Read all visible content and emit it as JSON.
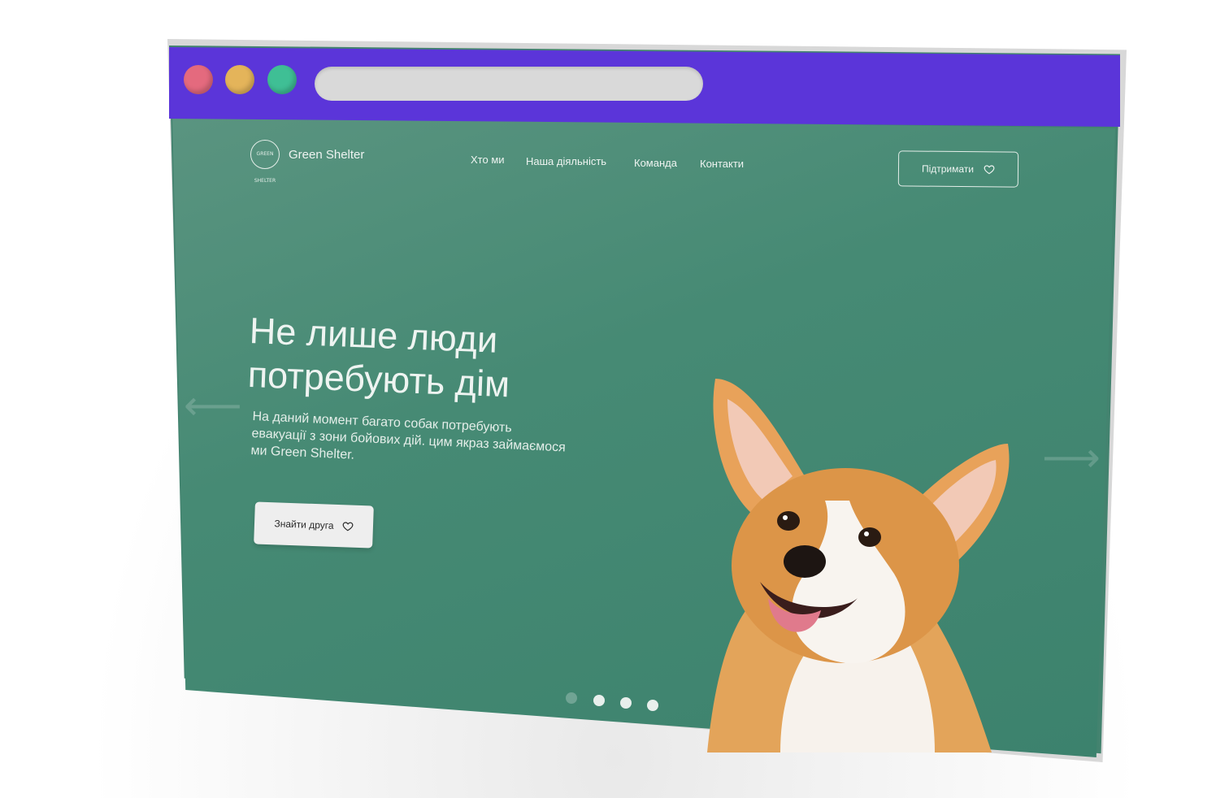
{
  "browser": {
    "window_buttons": [
      "close",
      "minimize",
      "maximize"
    ],
    "colors": {
      "titlebar": "#5b35d9",
      "page_bg": "#43836f",
      "close": "#e46a7e",
      "minimize": "#e4b45a",
      "maximize": "#3fbf95"
    }
  },
  "header": {
    "logo_text": "GREEN SHELTER",
    "brand": "Green Shelter",
    "nav": [
      "Хто ми",
      "Наша діяльність",
      "Команда",
      "Контакти"
    ],
    "support_button": "Підтримати"
  },
  "hero": {
    "title_line1": "Не лише люди",
    "title_line2": "потребують дім",
    "description": "На даний момент багато собак потребують евакуації з зони бойових дій. цим якраз займаємося ми Green Shelter.",
    "cta_button": "Знайти друга",
    "image": "corgi-dog",
    "slides_total": 4,
    "slide_active": 1
  }
}
